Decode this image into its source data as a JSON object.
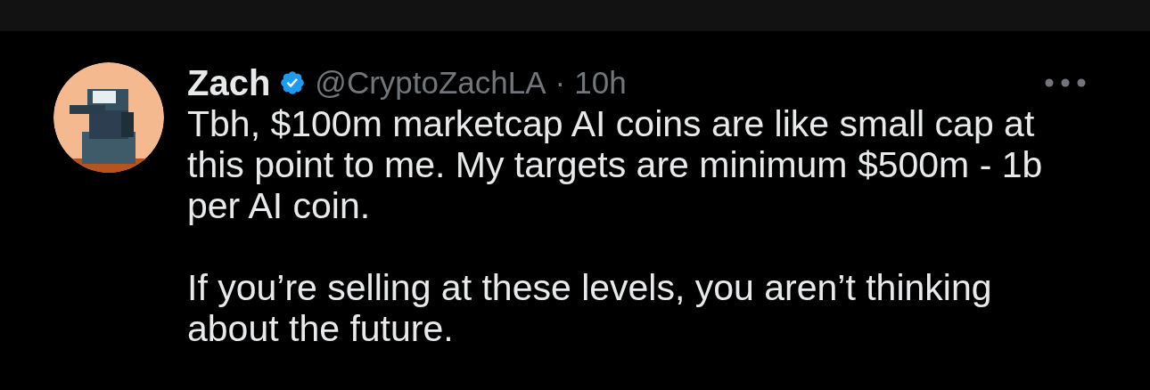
{
  "post": {
    "author": {
      "name": "Zach",
      "verified": true,
      "handle": "@CryptoZachLA",
      "separator": "·",
      "time": "10h"
    },
    "paragraphs": [
      "Tbh, $100m marketcap AI coins are like small cap at this point to me. My targets are minimum $500m - 1b per AI coin.",
      "If you’re selling at these levels, you aren’t thinking about the future."
    ]
  }
}
